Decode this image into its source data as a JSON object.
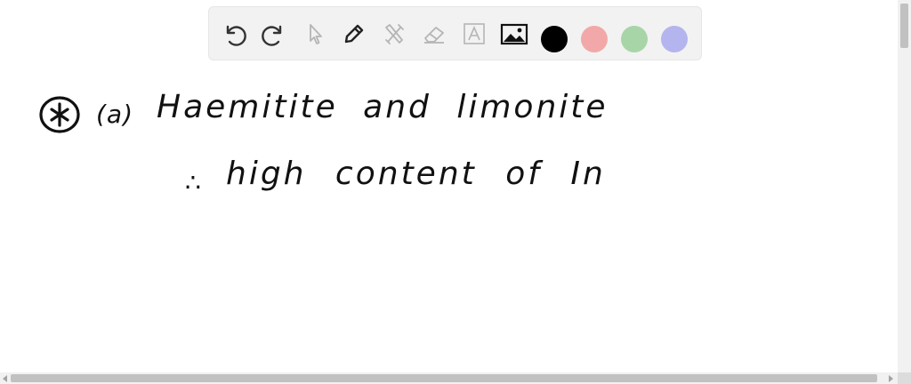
{
  "toolbar": {
    "tools": [
      {
        "name": "undo-icon",
        "state": "enabled"
      },
      {
        "name": "redo-icon",
        "state": "enabled"
      },
      {
        "name": "pointer-icon",
        "state": "disabled"
      },
      {
        "name": "pencil-icon",
        "state": "enabled"
      },
      {
        "name": "tools-icon",
        "state": "disabled"
      },
      {
        "name": "eraser-icon",
        "state": "disabled"
      },
      {
        "name": "text-icon",
        "state": "disabled"
      },
      {
        "name": "image-icon",
        "state": "enabled"
      }
    ],
    "colors": [
      "#000000",
      "#f2a8a8",
      "#a8d5a8",
      "#b4b4ee"
    ],
    "selected_color": "#000000"
  },
  "canvas": {
    "lines": [
      {
        "label": "(a)",
        "text": "Haemitite and limonite"
      },
      {
        "prefix": "∴",
        "text": "high content of In"
      }
    ]
  }
}
